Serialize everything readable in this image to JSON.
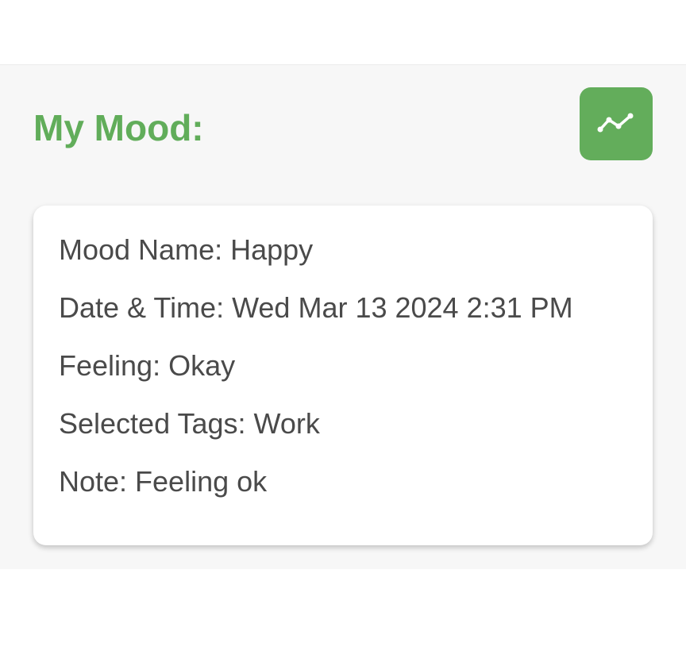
{
  "header": {
    "title": "My Mood:",
    "chart_button_icon": "trend-line-chart-icon"
  },
  "mood_entry": {
    "mood_name_label": "Mood Name: ",
    "mood_name": "Happy",
    "datetime_label": "Date & Time: ",
    "datetime": "Wed Mar 13 2024 2:31 PM",
    "feeling_label": "Feeling: ",
    "feeling": "Okay",
    "tags_label": "Selected Tags: ",
    "tags": "Work",
    "note_label": "Note: ",
    "note": "Feeling ok"
  },
  "colors": {
    "accent": "#61ad5a",
    "text": "#4a4a4a",
    "background": "#f7f7f7",
    "card": "#ffffff"
  }
}
